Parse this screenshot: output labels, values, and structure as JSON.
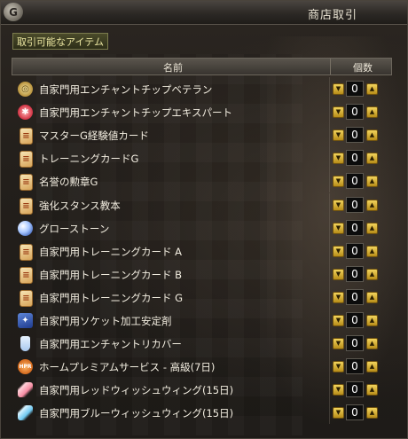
{
  "window": {
    "logo_glyph": "G",
    "title": "商店取引"
  },
  "filter_tab": {
    "label": "取引可能なアイテム"
  },
  "header": {
    "name_label": "名前",
    "qty_label": "個数"
  },
  "items": [
    {
      "name": "自家門用エンチャントチップベテラン",
      "qty": "0",
      "icon": "medal-icon",
      "icon_glyph": "◎",
      "icon_class": "icon-medal"
    },
    {
      "name": "自家門用エンチャントチップエキスパート",
      "qty": "0",
      "icon": "red-medal-icon",
      "icon_glyph": "✱",
      "icon_class": "icon-medal-red"
    },
    {
      "name": "マスターG経験値カード",
      "qty": "0",
      "icon": "card-icon",
      "icon_glyph": "≡",
      "icon_class": "icon-card"
    },
    {
      "name": "トレーニングカードG",
      "qty": "0",
      "icon": "card-icon",
      "icon_glyph": "≡",
      "icon_class": "icon-card"
    },
    {
      "name": "名誉の勲章G",
      "qty": "0",
      "icon": "card-icon",
      "icon_glyph": "≡",
      "icon_class": "icon-card"
    },
    {
      "name": "強化スタンス教本",
      "qty": "0",
      "icon": "card-icon",
      "icon_glyph": "≡",
      "icon_class": "icon-card"
    },
    {
      "name": "グローストーン",
      "qty": "0",
      "icon": "stone-icon",
      "icon_glyph": "",
      "icon_class": "icon-stone"
    },
    {
      "name": "自家門用トレーニングカード A",
      "qty": "0",
      "icon": "card-icon",
      "icon_glyph": "≡",
      "icon_class": "icon-card"
    },
    {
      "name": "自家門用トレーニングカード B",
      "qty": "0",
      "icon": "card-icon",
      "icon_glyph": "≡",
      "icon_class": "icon-card"
    },
    {
      "name": "自家門用トレーニングカード G",
      "qty": "0",
      "icon": "card-icon",
      "icon_glyph": "≡",
      "icon_class": "icon-card"
    },
    {
      "name": "自家門用ソケット加工安定剤",
      "qty": "0",
      "icon": "socket-icon",
      "icon_glyph": "✦",
      "icon_class": "icon-socket"
    },
    {
      "name": "自家門用エンチャントリカバー",
      "qty": "0",
      "icon": "flask-icon",
      "icon_glyph": "",
      "icon_class": "icon-flask"
    },
    {
      "name": "ホームプレミアムサービス - 高級(7日)",
      "qty": "0",
      "icon": "hpr-icon",
      "icon_glyph": "HPR",
      "icon_class": "icon-hpr"
    },
    {
      "name": "自家門用レッドウィッシュウィング(15日)",
      "qty": "0",
      "icon": "red-wing-icon",
      "icon_glyph": "",
      "icon_class": "icon-wing-red"
    },
    {
      "name": "自家門用ブルーウィッシュウィング(15日)",
      "qty": "0",
      "icon": "blue-wing-icon",
      "icon_glyph": "",
      "icon_class": "icon-wing-blue"
    }
  ],
  "controls": {
    "down_glyph": "▼",
    "up_glyph": "▲"
  }
}
